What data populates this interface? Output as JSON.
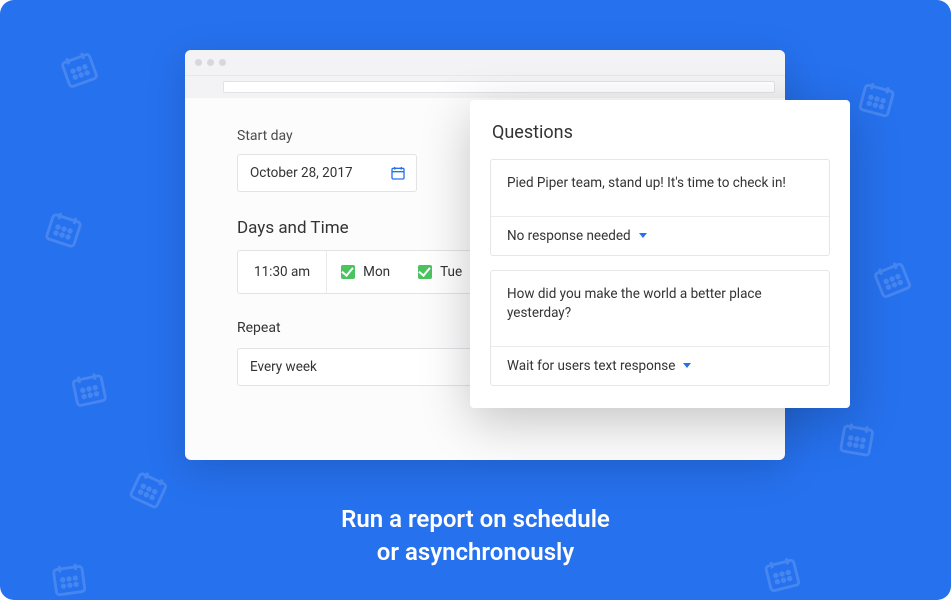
{
  "caption": {
    "line1": "Run a report on schedule",
    "line2": "or asynchronously"
  },
  "scheduler": {
    "start_day_label": "Start day",
    "start_day_value": "October 28, 2017",
    "days_time_label": "Days and Time",
    "time_value": "11:30 am",
    "days": [
      {
        "label": "Mon",
        "checked": true
      },
      {
        "label": "Tue",
        "checked": true
      }
    ],
    "repeat_label": "Repeat",
    "repeat_value": "Every week"
  },
  "questions": {
    "title": "Questions",
    "items": [
      {
        "prompt": "Pied Piper team, stand up! It's time to check in!",
        "response_mode": "No response needed"
      },
      {
        "prompt": "How did you make the world a better place yesterday?",
        "response_mode": "Wait for users text response"
      }
    ]
  }
}
